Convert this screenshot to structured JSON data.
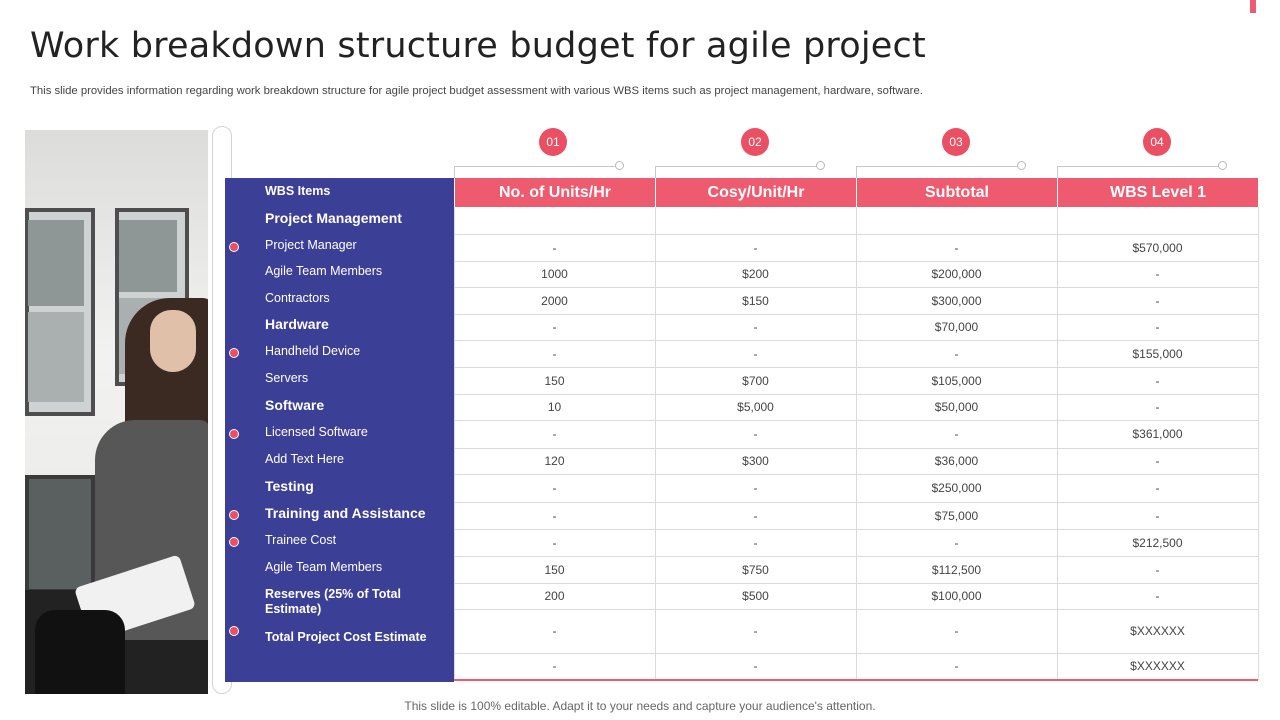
{
  "slide": {
    "title": "Work breakdown structure budget for agile project",
    "subtitle": "This slide provides information regarding work breakdown structure for agile project budget assessment with various WBS items such as project management, hardware, software.",
    "footer": "This slide is 100% editable. Adapt it to your needs and capture your audience's attention."
  },
  "steps": [
    "01",
    "02",
    "03",
    "04"
  ],
  "columns": [
    "No. of Units/Hr",
    "Cosy/Unit/Hr",
    "Subtotal",
    "WBS Level 1"
  ],
  "rows": [
    {
      "label": "WBS Items",
      "cells": [
        "",
        "",
        "",
        ""
      ],
      "style": "header"
    },
    {
      "label": "Project Management",
      "cells": [
        "-",
        "-",
        "-",
        "$570,000"
      ],
      "style": "group"
    },
    {
      "label": "Project Manager",
      "cells": [
        "1000",
        "$200",
        "$200,000",
        "-"
      ],
      "style": "item"
    },
    {
      "label": "Agile Team  Members",
      "cells": [
        "2000",
        "$150",
        "$300,000",
        "-"
      ],
      "style": "item"
    },
    {
      "label": "Contractors",
      "cells": [
        "-",
        "-",
        "$70,000",
        "-"
      ],
      "style": "item"
    },
    {
      "label": "Hardware",
      "cells": [
        "-",
        "-",
        "-",
        "$155,000"
      ],
      "style": "group"
    },
    {
      "label": "Handheld Device",
      "cells": [
        "150",
        "$700",
        "$105,000",
        "-"
      ],
      "style": "item"
    },
    {
      "label": "Servers",
      "cells": [
        "10",
        "$5,000",
        "$50,000",
        "-"
      ],
      "style": "item"
    },
    {
      "label": "Software",
      "cells": [
        "-",
        "-",
        "-",
        "$361,000"
      ],
      "style": "group"
    },
    {
      "label": "Licensed Software",
      "cells": [
        "120",
        "$300",
        "$36,000",
        "-"
      ],
      "style": "item"
    },
    {
      "label": "Add Text Here",
      "cells": [
        "-",
        "-",
        "$250,000",
        "-"
      ],
      "style": "item"
    },
    {
      "label": "Testing",
      "cells": [
        "-",
        "-",
        "$75,000",
        "-"
      ],
      "style": "group"
    },
    {
      "label": "Training and Assistance",
      "cells": [
        "-",
        "-",
        "-",
        "$212,500"
      ],
      "style": "group"
    },
    {
      "label": "Trainee  Cost",
      "cells": [
        "150",
        "$750",
        "$112,500",
        "-"
      ],
      "style": "item"
    },
    {
      "label": "Agile Team Members",
      "cells": [
        "200",
        "$500",
        "$100,000",
        "-"
      ],
      "style": "item"
    },
    {
      "label": "Reserves (25%  of Total Estimate)",
      "cells": [
        "-",
        "-",
        "-",
        "$XXXXXX"
      ],
      "style": "bold-small"
    },
    {
      "label": "Total Project Cost Estimate",
      "cells": [
        "-",
        "-",
        "-",
        "$XXXXXX"
      ],
      "style": "bold-small"
    }
  ],
  "colors": {
    "accent": "#ef5b6e",
    "panel": "#3b3f95"
  }
}
